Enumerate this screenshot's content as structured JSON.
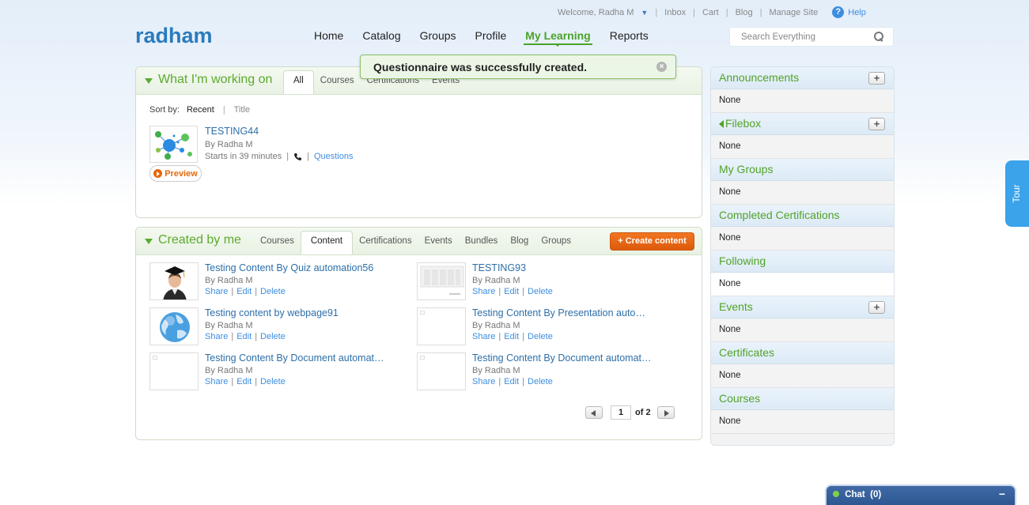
{
  "header": {
    "welcome": "Welcome, Radha M",
    "links": [
      "Inbox",
      "Cart",
      "Blog",
      "Manage Site"
    ],
    "help": "Help",
    "logo": "radham",
    "nav": [
      "Home",
      "Catalog",
      "Groups",
      "Profile",
      "My Learning",
      "Reports"
    ],
    "active_nav": "My Learning",
    "search_placeholder": "Search Everything"
  },
  "toast": {
    "message": "Questionnaire was successfully created."
  },
  "working": {
    "title": "What I'm working on",
    "tabs": [
      "All",
      "Courses",
      "Certifications",
      "Events"
    ],
    "active_tab": "All",
    "sort_label": "Sort by:",
    "sort_options": [
      "Recent",
      "Title"
    ],
    "item": {
      "title": "TESTING44",
      "byline": "By Radha M",
      "starts": "Starts in 39 minutes",
      "questions": "Questions",
      "preview": "Preview"
    }
  },
  "created": {
    "title": "Created by me",
    "tabs": [
      "Courses",
      "Content",
      "Certifications",
      "Events",
      "Bundles",
      "Blog",
      "Groups"
    ],
    "active_tab": "Content",
    "create_button": "+ Create content",
    "actions": [
      "Share",
      "Edit",
      "Delete"
    ],
    "items": [
      {
        "title": "Testing Content By Quiz automation56",
        "byline": "By Radha M",
        "thumb": "graduate-avatar"
      },
      {
        "title": "TESTING93",
        "byline": "By Radha M",
        "thumb": "slide-preview"
      },
      {
        "title": "Testing content by webpage91",
        "byline": "By Radha M",
        "thumb": "globe"
      },
      {
        "title": "Testing Content By Presentation auto…",
        "byline": "By Radha M",
        "thumb": "blank"
      },
      {
        "title": "Testing Content By Document automat…",
        "byline": "By Radha M",
        "thumb": "blank"
      },
      {
        "title": "Testing Content By Document automat…",
        "byline": "By Radha M",
        "thumb": "blank"
      }
    ],
    "pager": {
      "page": "1",
      "of": "of 2"
    }
  },
  "sidebar": {
    "sections": [
      {
        "title": "Announcements",
        "body": "None",
        "plus": true
      },
      {
        "title": "Filebox",
        "body": "None",
        "plus": true
      },
      {
        "title": "My Groups",
        "body": "None",
        "plus": false
      },
      {
        "title": "Completed Certifications",
        "body": "None",
        "plus": false
      },
      {
        "title": "Following",
        "body": "None",
        "plus": false
      },
      {
        "title": "Events",
        "body": "None",
        "plus": true
      },
      {
        "title": "Certificates",
        "body": "None",
        "plus": false
      },
      {
        "title": "Courses",
        "body": "None",
        "plus": false
      }
    ]
  },
  "tour": "Tour",
  "chat": {
    "label": "Chat",
    "count": "(0)"
  },
  "colors": {
    "brand": "#2b7bbd",
    "green": "#5caa2f",
    "orange": "#e8650c",
    "link": "#3d8de0"
  }
}
